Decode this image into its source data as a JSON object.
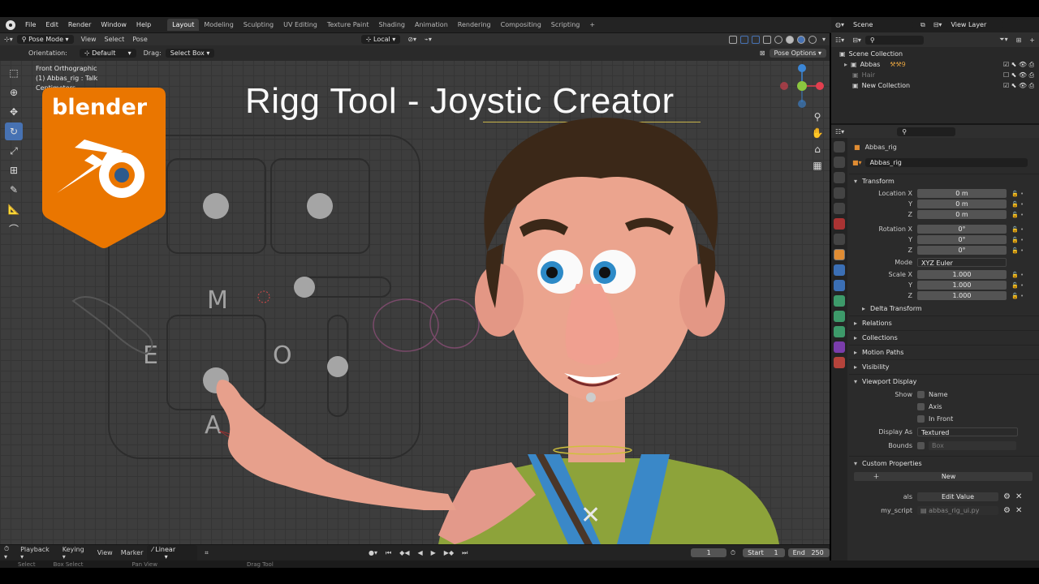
{
  "topbar": {
    "menus": [
      "File",
      "Edit",
      "Render",
      "Window",
      "Help"
    ],
    "workspaces": [
      "Layout",
      "Modeling",
      "Sculpting",
      "UV Editing",
      "Texture Paint",
      "Shading",
      "Animation",
      "Rendering",
      "Compositing",
      "Scripting"
    ],
    "active_workspace": "Layout",
    "scene": "Scene",
    "view_layer": "View Layer"
  },
  "viewport_header": {
    "mode": "Pose Mode",
    "menus": [
      "View",
      "Select",
      "Pose"
    ],
    "transform_space": "Local",
    "orientation_label": "Orientation:",
    "orientation_value": "Default",
    "drag_label": "Drag:",
    "drag_value": "Select Box",
    "pose_options": "Pose Options"
  },
  "viewport": {
    "view_name": "Front Orthographic",
    "object_info": "(1) Abbas_rig : Talk",
    "units": "Centimeters",
    "overlay_title": "Rigg Tool - Joystic Creator",
    "badge_text": "blender",
    "rig_letters": [
      "M",
      "E",
      "O",
      "A"
    ]
  },
  "timeline": {
    "menus": [
      "Playback",
      "Keying",
      "View",
      "Marker"
    ],
    "interpolation": "Linear",
    "current_frame": "1",
    "start_label": "Start",
    "start": "1",
    "end_label": "End",
    "end": "250"
  },
  "statusbar": {
    "items": [
      "Select",
      "Box Select",
      "Pan View",
      "Drag Tool"
    ]
  },
  "outliner": {
    "rows": [
      {
        "label": "Scene Collection",
        "dim": false
      },
      {
        "label": "Abbas",
        "dim": false
      },
      {
        "label": "Hair",
        "dim": true
      },
      {
        "label": "New Collection",
        "dim": false
      }
    ]
  },
  "properties": {
    "object_name": "Abbas_rig",
    "data_name": "Abbas_rig",
    "transform_label": "Transform",
    "location": {
      "label": "Location X",
      "x": "0 m",
      "y": "0 m",
      "z": "0 m"
    },
    "rotation": {
      "label": "Rotation X",
      "x": "0°",
      "y": "0°",
      "z": "0°"
    },
    "mode_label": "Mode",
    "mode_value": "XYZ Euler",
    "scale": {
      "label": "Scale X",
      "x": "1.000",
      "y": "1.000",
      "z": "1.000"
    },
    "axis_y": "Y",
    "axis_z": "Z",
    "delta_transform": "Delta Transform",
    "panels": [
      "Relations",
      "Collections",
      "Motion Paths",
      "Visibility"
    ],
    "viewport_display": "Viewport Display",
    "show_label": "Show",
    "show_options": [
      "Name",
      "Axis",
      "In Front"
    ],
    "display_as_label": "Display As",
    "display_as_value": "Textured",
    "bounds_label": "Bounds",
    "bounds_value": "Box",
    "custom_properties": "Custom Properties",
    "new_button": "New",
    "custom_props": [
      {
        "name": "als",
        "value": "Edit Value"
      },
      {
        "name": "my_script",
        "value": "abbas_rig_ui.py"
      }
    ]
  },
  "colors": {
    "accent": "#4772b3",
    "blender_orange": "#ea7600",
    "x_axis": "#e23f4f",
    "y_axis": "#8bc63f",
    "z_axis": "#3b86d6"
  }
}
